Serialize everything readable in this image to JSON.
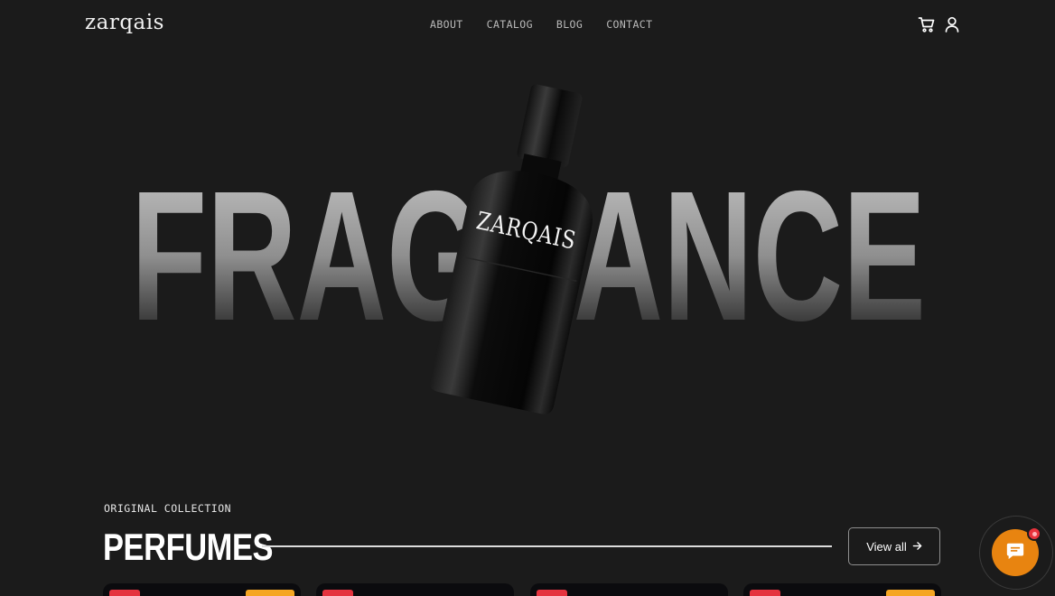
{
  "brand": {
    "logo_text": "zarqais"
  },
  "nav": {
    "items": [
      "ABOUT",
      "CATALOG",
      "BLOG",
      "CONTACT"
    ]
  },
  "header_icons": [
    "cart-icon",
    "user-icon"
  ],
  "hero": {
    "word": "FRAGRANCE",
    "bottle_label": "ZARQAIS"
  },
  "section": {
    "eyebrow": "ORIGINAL COLLECTION",
    "title": "PERFUMES",
    "view_all_label": "View all"
  },
  "cards": [
    {
      "badges": [
        "sale-badge",
        "tag-badge"
      ]
    },
    {
      "badges": [
        "sale-badge"
      ]
    },
    {
      "badges": [
        "sale-badge"
      ]
    },
    {
      "badges": [
        "sale-badge",
        "tag-badge"
      ]
    }
  ],
  "chat": {
    "icon": "chat-icon"
  },
  "colors": {
    "background": "#1b1b1b",
    "accent": "#e88410",
    "badge_red": "#e5333f",
    "badge_amber": "#f5a623"
  }
}
